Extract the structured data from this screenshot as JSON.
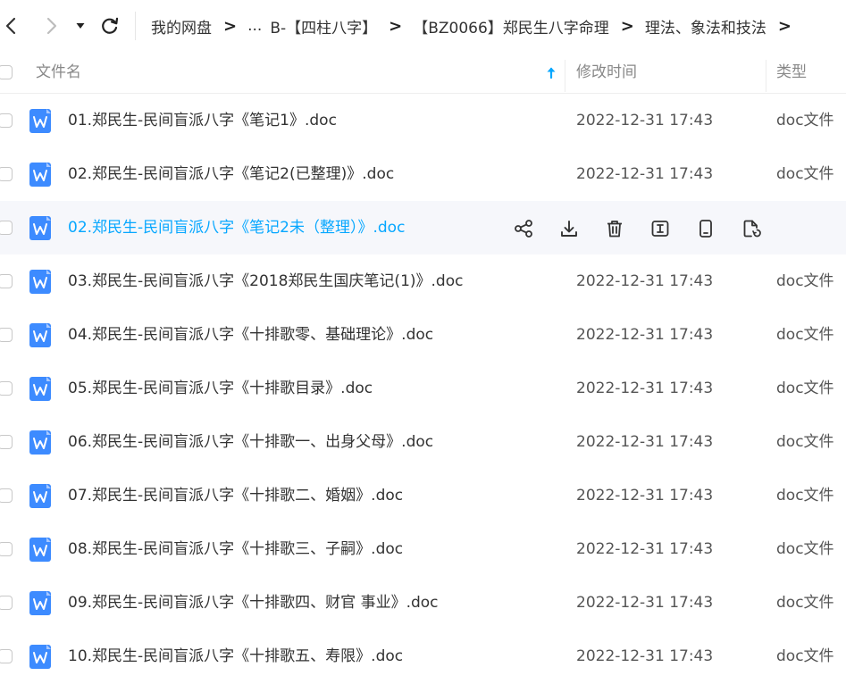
{
  "nav": {
    "back_icon": "chevron-left-icon",
    "forward_icon": "chevron-right-icon",
    "dropdown_icon": "caret-down-icon",
    "refresh_icon": "refresh-icon"
  },
  "breadcrumb": {
    "root": "我的网盘",
    "ellipsis": "...",
    "items": [
      "B-【四柱八字】",
      "【BZ0066】郑民生八字命理",
      "理法、象法和技法"
    ],
    "separator": ">"
  },
  "table": {
    "headers": {
      "name": "文件名",
      "modified": "修改时间",
      "type": "类型"
    },
    "sort_icon": "arrow-up-icon",
    "rows": [
      {
        "name": "01.郑民生-民间盲派八字《笔记1》.doc",
        "modified": "2022-12-31 17:43",
        "type": "doc文件"
      },
      {
        "name": "02.郑民生-民间盲派八字《笔记2(已整理)》.doc",
        "modified": "2022-12-31 17:43",
        "type": "doc文件"
      },
      {
        "name": "02.郑民生-民间盲派八字《笔记2未（整理）》.doc",
        "modified": "",
        "type": ""
      },
      {
        "name": "03.郑民生-民间盲派八字《2018郑民生国庆笔记(1)》.doc",
        "modified": "2022-12-31 17:43",
        "type": "doc文件"
      },
      {
        "name": "04.郑民生-民间盲派八字《十排歌零、基础理论》.doc",
        "modified": "2022-12-31 17:43",
        "type": "doc文件"
      },
      {
        "name": "05.郑民生-民间盲派八字《十排歌目录》.doc",
        "modified": "2022-12-31 17:43",
        "type": "doc文件"
      },
      {
        "name": "06.郑民生-民间盲派八字《十排歌一、出身父母》.doc",
        "modified": "2022-12-31 17:43",
        "type": "doc文件"
      },
      {
        "name": "07.郑民生-民间盲派八字《十排歌二、婚姻》.doc",
        "modified": "2022-12-31 17:43",
        "type": "doc文件"
      },
      {
        "name": "08.郑民生-民间盲派八字《十排歌三、子嗣》.doc",
        "modified": "2022-12-31 17:43",
        "type": "doc文件"
      },
      {
        "name": "09.郑民生-民间盲派八字《十排歌四、财官 事业》.doc",
        "modified": "2022-12-31 17:43",
        "type": "doc文件"
      },
      {
        "name": "10.郑民生-民间盲派八字《十排歌五、寿限》.doc",
        "modified": "2022-12-31 17:43",
        "type": "doc文件"
      }
    ]
  },
  "hover_actions": [
    "share-icon",
    "download-icon",
    "delete-icon",
    "rename-icon",
    "phone-icon",
    "copy-file-icon"
  ],
  "colors": {
    "accent": "#06a7ff",
    "doc_icon": "#3d8bff",
    "hover_bg": "#f6f7fb"
  }
}
